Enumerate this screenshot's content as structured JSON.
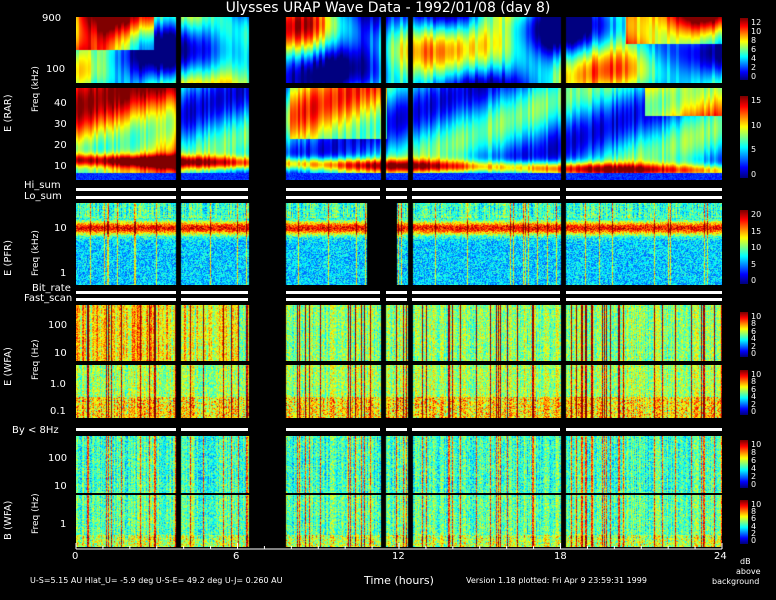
{
  "title": "Ulysses URAP Wave Data - 1992/01/08 (day 8)",
  "footer": {
    "left": "U-S=5.15 AU  Hlat_U= -5.9 deg  U-S-E= 49.2 deg  U-J= 0.260 AU",
    "xlabel": "Time (hours)",
    "version": "Version 1.18 plotted: Fri Apr  9 23:59:31 1999",
    "db_note": [
      "dB",
      "above",
      "background"
    ]
  },
  "xticks": [
    "0",
    "6",
    "12",
    "18",
    "24"
  ],
  "strips": {
    "hi_sum": "Hi_sum",
    "lo_sum": "Lo_sum",
    "bit_rate": "Bit_rate",
    "fast_scan": "Fast_scan",
    "by_8hz": "By < 8Hz"
  },
  "groups": {
    "rar": "E (RAR)",
    "pfr": "E (PFR)",
    "wfa_e": "E (WFA)",
    "wfa_b": "B (WFA)",
    "freq_khz": "Freq (kHz)",
    "freq_hz": "Freq (Hz)"
  },
  "panels": {
    "rar_high": {
      "yticks": [
        "900",
        "100"
      ],
      "cbar": [
        "12",
        "10",
        "8",
        "6",
        "4",
        "2",
        "0"
      ]
    },
    "rar_low": {
      "yticks": [
        "40",
        "30",
        "20",
        "10"
      ],
      "cbar": [
        "15",
        "10",
        "5",
        "0"
      ]
    },
    "pfr": {
      "yticks": [
        "10",
        "1"
      ],
      "cbar": [
        "20",
        "15",
        "10",
        "5",
        "0"
      ]
    },
    "wfa_e_high": {
      "yticks": [
        "100",
        "10"
      ],
      "cbar": [
        "10",
        "8",
        "6",
        "4",
        "2",
        "0"
      ]
    },
    "wfa_e_low": {
      "yticks": [
        "1.0",
        "0.1"
      ],
      "cbar": [
        "10",
        "8",
        "6",
        "4",
        "2",
        "0"
      ]
    },
    "wfa_b_high": {
      "yticks": [
        "100",
        "10"
      ],
      "cbar": [
        "10",
        "8",
        "6",
        "4",
        "2",
        "0"
      ]
    },
    "wfa_b_low": {
      "yticks": [
        "1"
      ],
      "cbar": [
        "10",
        "8",
        "6",
        "4",
        "2",
        "0"
      ]
    }
  },
  "chart_data": {
    "type": "heatmap",
    "title": "Ulysses URAP Wave Data - 1992/01/08 (day 8)",
    "xlabel": "Time (hours)",
    "xlim": [
      0,
      24
    ],
    "xticks": [
      0,
      6,
      12,
      18,
      24
    ],
    "colorbar_units": "dB above background",
    "data_gaps_hours": [
      [
        3.7,
        3.9
      ],
      [
        6.4,
        7.8
      ],
      [
        11.3,
        11.5
      ],
      [
        12.3,
        12.5
      ],
      [
        18.0,
        18.2
      ]
    ],
    "pfr_gap_hours": [
      10.8,
      11.9
    ],
    "panels": [
      {
        "name": "E (RAR) high",
        "yticks": [
          900,
          100
        ],
        "ylabel": "Freq (kHz)",
        "cbar_range": [
          0,
          12
        ]
      },
      {
        "name": "E (RAR) low",
        "yticks": [
          40,
          30,
          20,
          10
        ],
        "ylabel": "Freq (kHz)",
        "cbar_range": [
          0,
          15
        ]
      },
      {
        "name": "E (PFR)",
        "yticks": [
          10,
          1
        ],
        "ylabel": "Freq (kHz)",
        "cbar_range": [
          0,
          20
        ]
      },
      {
        "name": "E (WFA) high",
        "yticks": [
          100,
          10
        ],
        "ylabel": "Freq (Hz)",
        "cbar_range": [
          0,
          10
        ]
      },
      {
        "name": "E (WFA) low",
        "yticks": [
          1.0,
          0.1
        ],
        "ylabel": "Freq (Hz)",
        "cbar_range": [
          0,
          10
        ]
      },
      {
        "name": "B (WFA) high",
        "yticks": [
          100,
          10
        ],
        "ylabel": "Freq (Hz)",
        "cbar_range": [
          0,
          10
        ]
      },
      {
        "name": "B (WFA) low",
        "yticks": [
          1
        ],
        "ylabel": "Freq (Hz)",
        "cbar_range": [
          0,
          10
        ]
      }
    ]
  }
}
